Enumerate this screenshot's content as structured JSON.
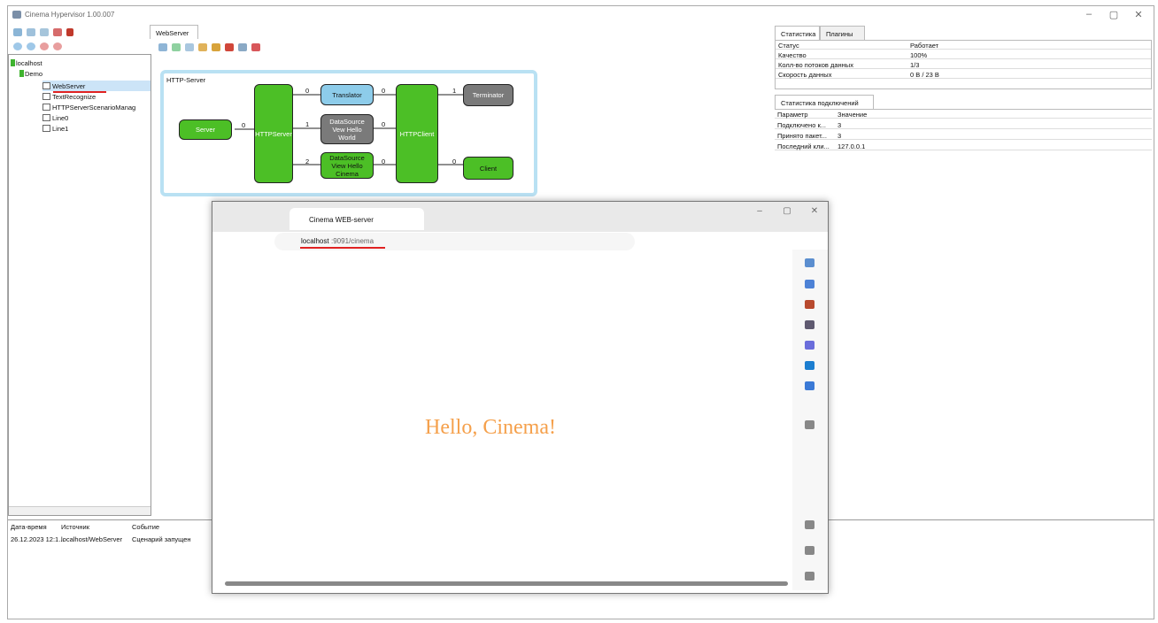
{
  "app": {
    "title": "Cinema Hypervisor 1.00.007",
    "window": {
      "minimize": "–",
      "maximize": "▢",
      "close": "✕"
    }
  },
  "editor": {
    "tab": "WebServer",
    "diagram_title": "HTTP-Server",
    "blocks": {
      "server": "Server",
      "httpserver": "HTTPServer",
      "translator": "Translator",
      "ds1": "DataSource\nVew Hello\nWorld",
      "ds2": "DataSource\nView Hello\nCinema",
      "httpclient": "HTTPClient",
      "terminator": "Terminator",
      "client": "Client"
    },
    "ports": {
      "p1": "0",
      "p2": "0",
      "p3": "1",
      "p4": "2",
      "p5": "0",
      "p6": "0",
      "p7": "1",
      "p8": "0",
      "p9": "0"
    }
  },
  "tree": {
    "items": [
      {
        "label": "localhost"
      },
      {
        "label": "Demo"
      },
      {
        "label": "WebServer"
      },
      {
        "label": "TextRecognize"
      },
      {
        "label": "HTTPServerScenarioManag"
      },
      {
        "label": "Line0"
      },
      {
        "label": "Line1"
      }
    ]
  },
  "stats": {
    "tabs": [
      "Статистика",
      "Плагины"
    ],
    "rows": [
      {
        "k": "Статус",
        "v": "Работает"
      },
      {
        "k": "Качество",
        "v": "100%"
      },
      {
        "k": "Колл-во потоков данных",
        "v": "1/3"
      },
      {
        "k": "Скорость данных",
        "v": "0 B / 23 B"
      }
    ],
    "conn_tab": "Статистика подключений",
    "conn_headers": [
      "Параметр",
      "Значение"
    ],
    "conn_rows": [
      {
        "k": "Подключено к...",
        "v": "3"
      },
      {
        "k": "Принято пакет...",
        "v": "3"
      },
      {
        "k": "Последний кли...",
        "v": "127.0.0.1"
      }
    ]
  },
  "log": {
    "headers": [
      "Дата-время",
      "Источник",
      "Событие"
    ],
    "rows": [
      {
        "time": "26.12.2023 12:1...",
        "source": "localhost/WebServer",
        "event": "Сценарий запущен"
      }
    ]
  },
  "browser": {
    "tab_title": "Cinema WEB-server",
    "address_host": "localhost",
    "address_rest": ":9091/cinema",
    "page_text": "Hello, Cinema!",
    "window": {
      "minimize": "–",
      "maximize": "▢",
      "close": "✕"
    }
  },
  "colors": {
    "green": "#4cbf26",
    "gray": "#7a7a7a",
    "blue": "#8dccea",
    "hello": "#f5a04b",
    "selection": "#cce4f7"
  },
  "icons": [
    "search-icon",
    "tag-icon",
    "briefcase-icon",
    "chess-icon",
    "office-icon",
    "outlook-icon",
    "message-icon",
    "add-icon",
    "sidebar-icon",
    "popout-icon",
    "settings-icon"
  ]
}
